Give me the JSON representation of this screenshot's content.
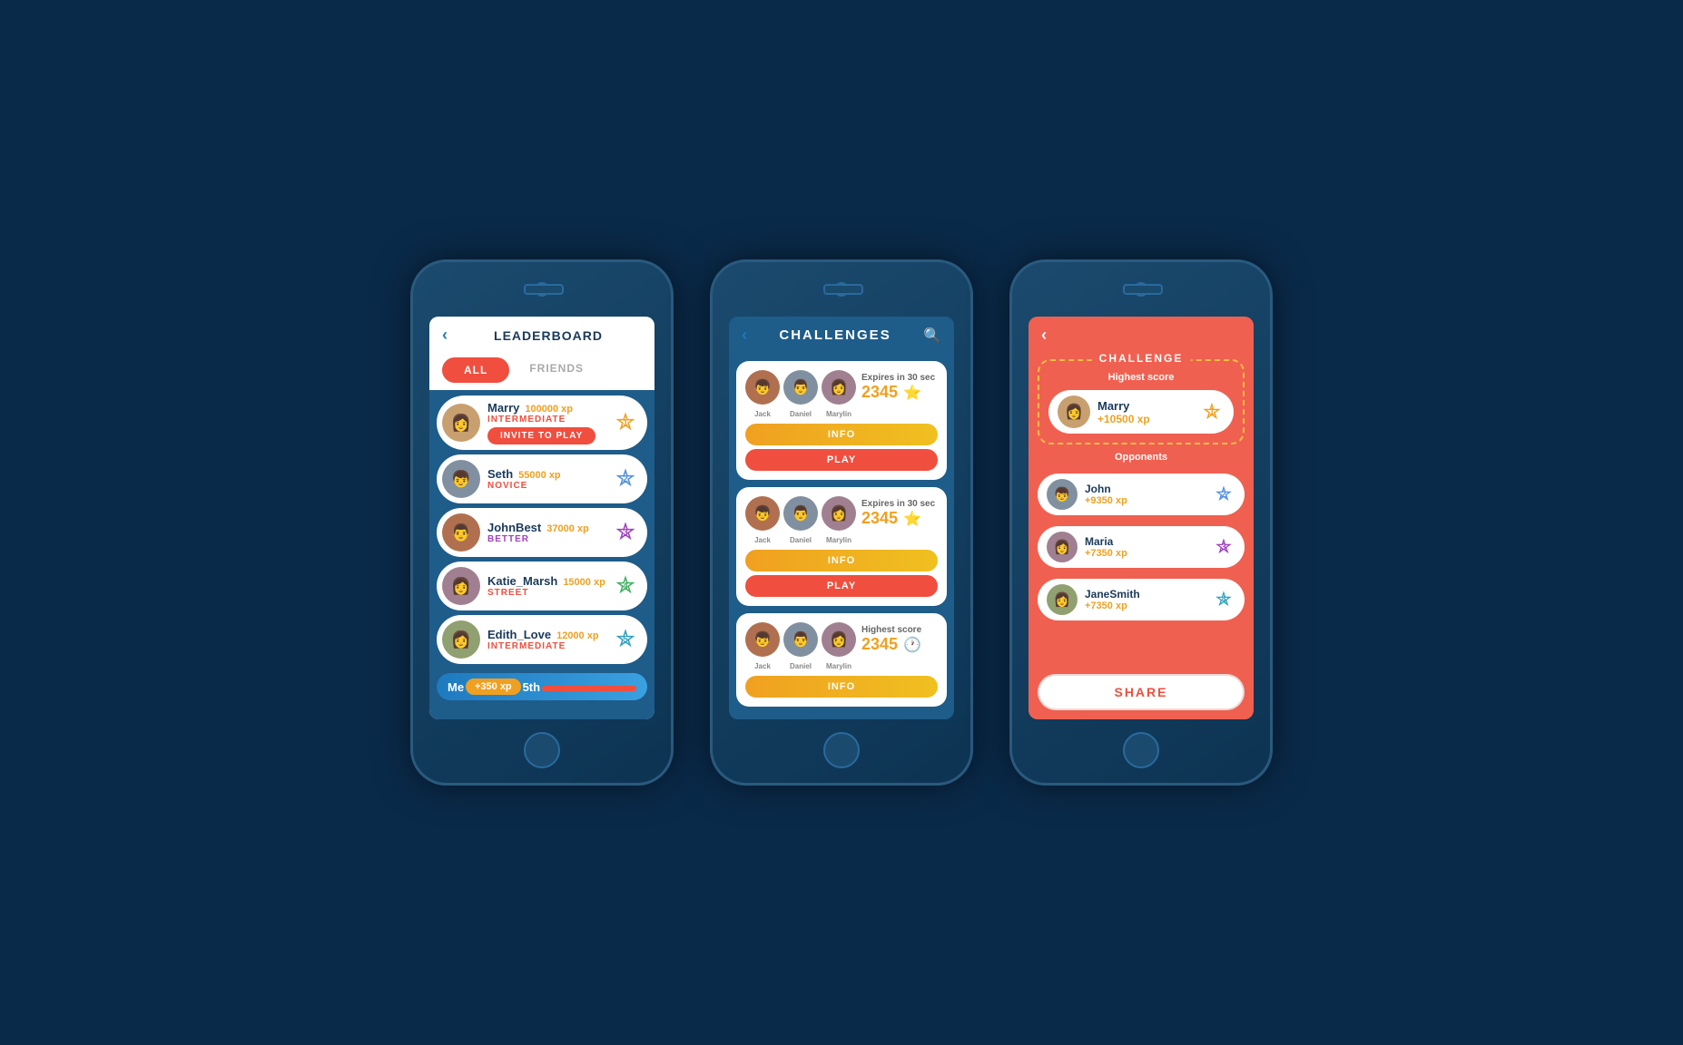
{
  "leaderboard": {
    "title": "LEADERBOARD",
    "tab_all": "ALL",
    "tab_friends": "FRIENDS",
    "back_icon": "‹",
    "entries": [
      {
        "name": "Marry",
        "xp": "100000 xp",
        "level": "INTERMEDIATE",
        "level_class": "intermediate",
        "badge_rank": "1",
        "badge_class": "badge-gold",
        "invite_label": "INVITE TO PLAY",
        "emoji": "👩",
        "av_class": "av-1"
      },
      {
        "name": "Seth",
        "xp": "55000 xp",
        "level": "NOVICE",
        "level_class": "novice",
        "badge_rank": "2",
        "badge_class": "badge-blue",
        "emoji": "👦",
        "av_class": "av-2"
      },
      {
        "name": "JohnBest",
        "xp": "37000 xp",
        "level": "BETTER",
        "level_class": "better",
        "badge_rank": "3",
        "badge_class": "badge-purple",
        "emoji": "👨",
        "av_class": "av-3"
      },
      {
        "name": "Katie_Marsh",
        "xp": "15000 xp",
        "level": "STREET",
        "level_class": "street",
        "badge_rank": "4",
        "badge_class": "badge-green",
        "emoji": "👩",
        "av_class": "av-4"
      },
      {
        "name": "Edith_Love",
        "xp": "12000 xp",
        "level": "INTERMEDIATE",
        "level_class": "intermediate",
        "badge_rank": "5",
        "badge_class": "badge-teal",
        "emoji": "👩",
        "av_class": "av-5"
      }
    ],
    "me_label": "Me",
    "me_xp": "+350 xp",
    "me_rank": "5th"
  },
  "challenges": {
    "title": "CHALLENGES",
    "back_icon": "‹",
    "search_icon": "🔍",
    "cards": [
      {
        "expires": "Expires in 30 sec",
        "score": "2345",
        "score_icon": "⭐",
        "players": [
          "Jack",
          "Daniel",
          "Marylin"
        ],
        "has_play": true
      },
      {
        "expires": "Expires in 30 sec",
        "score": "2345",
        "score_icon": "⭐",
        "players": [
          "Jack",
          "Daniel",
          "Marylin"
        ],
        "has_play": true
      },
      {
        "expires": "Highest score",
        "score": "2345",
        "score_icon": "🕐",
        "players": [
          "Jack",
          "Daniel",
          "Marylin"
        ],
        "has_play": false
      }
    ],
    "btn_info": "INFO",
    "btn_play": "PLAY"
  },
  "challenge_detail": {
    "back_icon": "‹",
    "box_label": "CHALLENGE",
    "subtitle": "Highest score",
    "opponents_label": "Opponents",
    "winner": {
      "name": "Marry",
      "xp": "+10500 xp",
      "emoji": "👩",
      "av_class": "av-1",
      "badge_rank": "1",
      "badge_class": "badge-gold"
    },
    "opponents": [
      {
        "name": "John",
        "xp": "+9350 xp",
        "emoji": "👦",
        "av_class": "av-2",
        "badge_rank": "2",
        "badge_class": "badge-blue"
      },
      {
        "name": "Maria",
        "xp": "+7350 xp",
        "emoji": "👩",
        "av_class": "av-4",
        "badge_rank": "3",
        "badge_class": "badge-purple"
      },
      {
        "name": "JaneSmith",
        "xp": "+7350 xp",
        "emoji": "👩",
        "av_class": "av-5",
        "badge_rank": "4",
        "badge_class": "badge-teal"
      }
    ],
    "share_label": "SHARE"
  }
}
